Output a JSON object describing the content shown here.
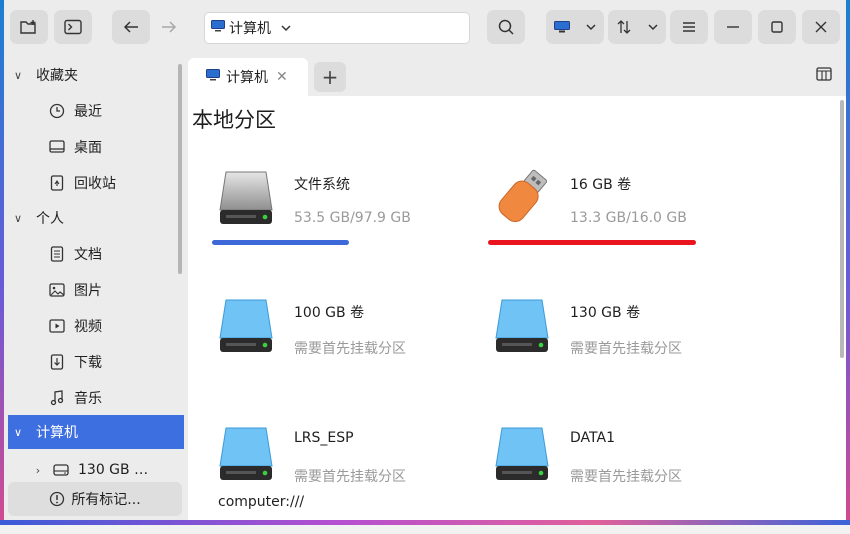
{
  "toolbar": {
    "address_text": "计算机"
  },
  "sidebar": {
    "groups": [
      {
        "label": "收藏夹",
        "items": [
          {
            "label": "最近"
          },
          {
            "label": "桌面"
          },
          {
            "label": "回收站"
          }
        ]
      },
      {
        "label": "个人",
        "items": [
          {
            "label": "文档"
          },
          {
            "label": "图片"
          },
          {
            "label": "视频"
          },
          {
            "label": "下载"
          },
          {
            "label": "音乐"
          }
        ]
      },
      {
        "label": "计算机",
        "items": [
          {
            "label": "130 GB …"
          }
        ]
      }
    ],
    "bottom_button": "所有标记..."
  },
  "tabs": [
    {
      "label": "计算机"
    }
  ],
  "content": {
    "section_title": "本地分区",
    "drives": [
      {
        "name": "文件系统",
        "info": "53.5 GB/97.9 GB",
        "usage": 0.546,
        "bar_color": "#3d68d8",
        "icon": "hard-disk-icon"
      },
      {
        "name": "16 GB 卷",
        "info": "13.3 GB/16.0 GB",
        "usage": 0.831,
        "bar_color": "#e8141e",
        "icon": "usb-drive-icon"
      },
      {
        "name": "100 GB 卷",
        "info": "需要首先挂载分区",
        "icon": "drive-icon"
      },
      {
        "name": "130 GB 卷",
        "info": "需要首先挂载分区",
        "icon": "drive-icon"
      },
      {
        "name": "LRS_ESP",
        "info": "需要首先挂载分区",
        "icon": "drive-icon"
      },
      {
        "name": "DATA1",
        "info": "需要首先挂载分区",
        "icon": "drive-icon"
      }
    ],
    "status_text": "computer:///"
  }
}
